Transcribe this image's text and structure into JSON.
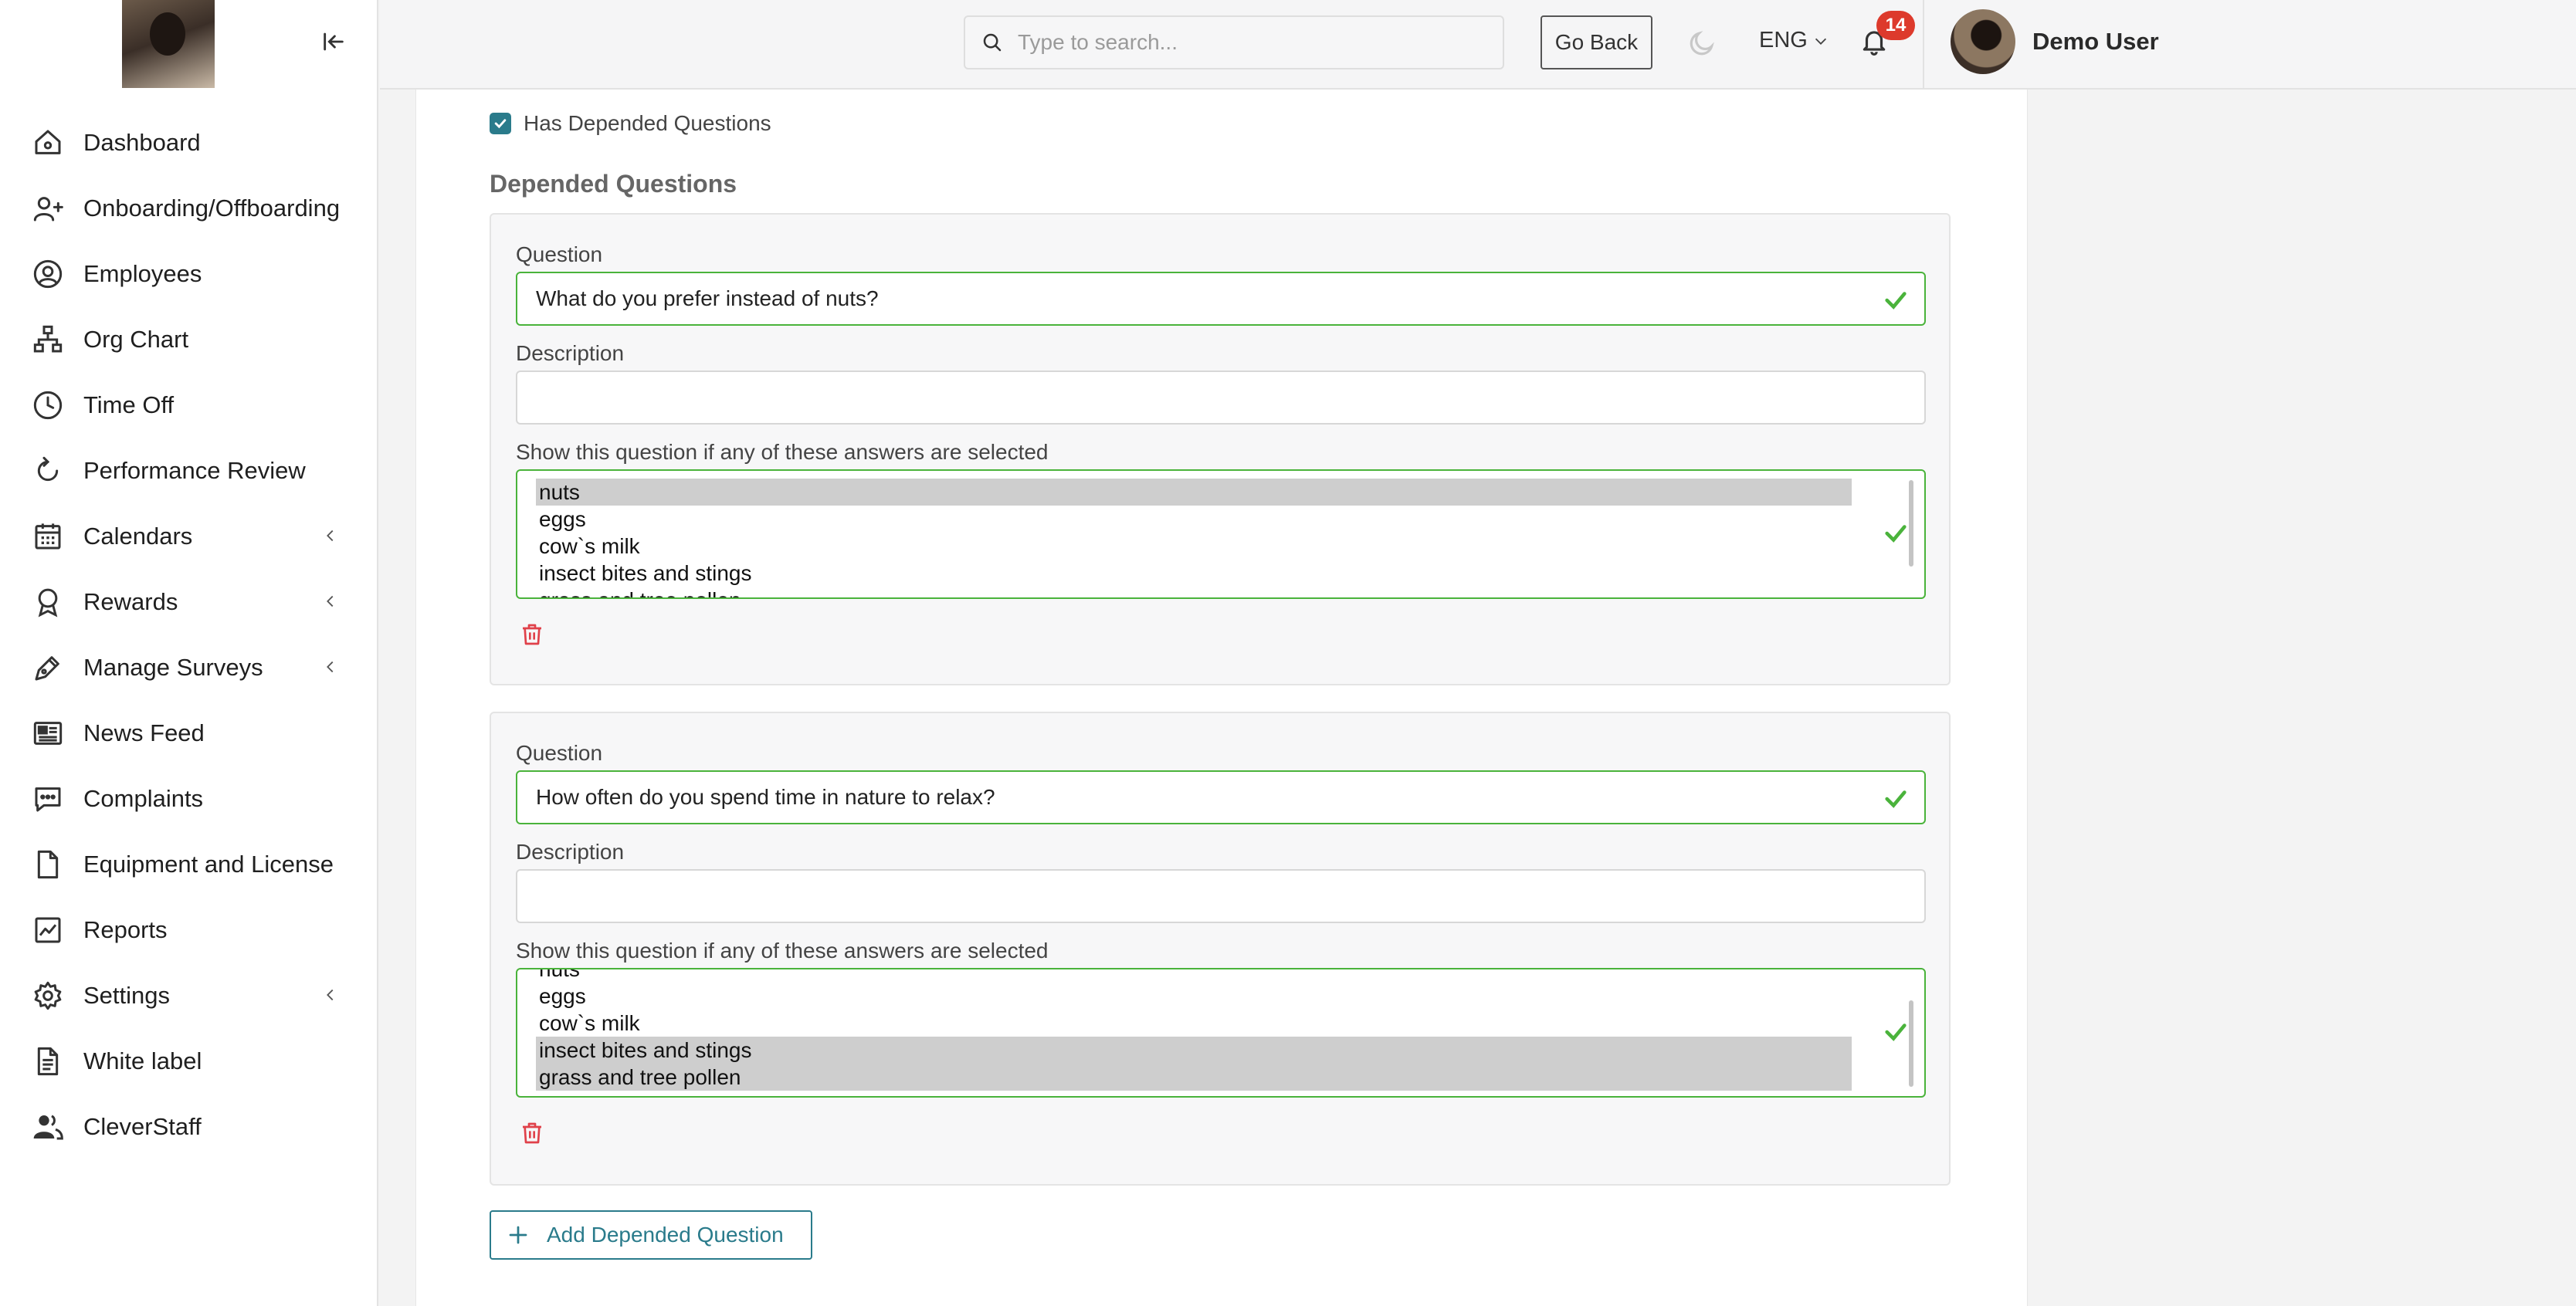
{
  "header": {
    "search_placeholder": "Type to search...",
    "go_back_label": "Go Back",
    "language": "ENG",
    "notification_count": "14",
    "user_name": "Demo User"
  },
  "sidebar": {
    "items": [
      {
        "label": "Dashboard",
        "icon": "home-icon"
      },
      {
        "label": "Onboarding/Offboarding",
        "icon": "user-plus-icon"
      },
      {
        "label": "Employees",
        "icon": "user-circle-icon"
      },
      {
        "label": "Org Chart",
        "icon": "org-chart-icon"
      },
      {
        "label": "Time Off",
        "icon": "clock-icon"
      },
      {
        "label": "Performance Review",
        "icon": "refresh-icon"
      },
      {
        "label": "Calendars",
        "icon": "calendar-icon",
        "expandable": true
      },
      {
        "label": "Rewards",
        "icon": "award-icon",
        "expandable": true
      },
      {
        "label": "Manage Surveys",
        "icon": "pen-icon",
        "expandable": true
      },
      {
        "label": "News Feed",
        "icon": "newspaper-icon"
      },
      {
        "label": "Complaints",
        "icon": "chat-icon"
      },
      {
        "label": "Equipment and License",
        "icon": "file-icon"
      },
      {
        "label": "Reports",
        "icon": "chart-icon"
      },
      {
        "label": "Settings",
        "icon": "gear-icon",
        "expandable": true
      },
      {
        "label": "White label",
        "icon": "document-icon"
      },
      {
        "label": "CleverStaff",
        "icon": "users-icon"
      }
    ]
  },
  "form": {
    "has_depended_label": "Has Depended Questions",
    "section_title": "Depended Questions",
    "question_label": "Question",
    "description_label": "Description",
    "show_if_label": "Show this question if any of these answers are selected",
    "add_button_label": "Add Depended Question",
    "questions": [
      {
        "question": "What do you prefer instead of nuts?",
        "description": "",
        "options": [
          "nuts",
          "eggs",
          "cow`s milk",
          "insect bites and stings",
          "grass and tree pollen"
        ],
        "selected": [
          "nuts"
        ]
      },
      {
        "question": "How often do you spend time in nature to relax?",
        "description": "",
        "options": [
          "nuts",
          "eggs",
          "cow`s milk",
          "insect bites and stings",
          "grass and tree pollen"
        ],
        "selected": [
          "insect bites and stings",
          "grass and tree pollen"
        ]
      }
    ]
  },
  "colors": {
    "accent": "#2a7b8b",
    "valid": "#4ab33b",
    "danger": "#dd3a2c",
    "selected_option": "#cecece"
  }
}
